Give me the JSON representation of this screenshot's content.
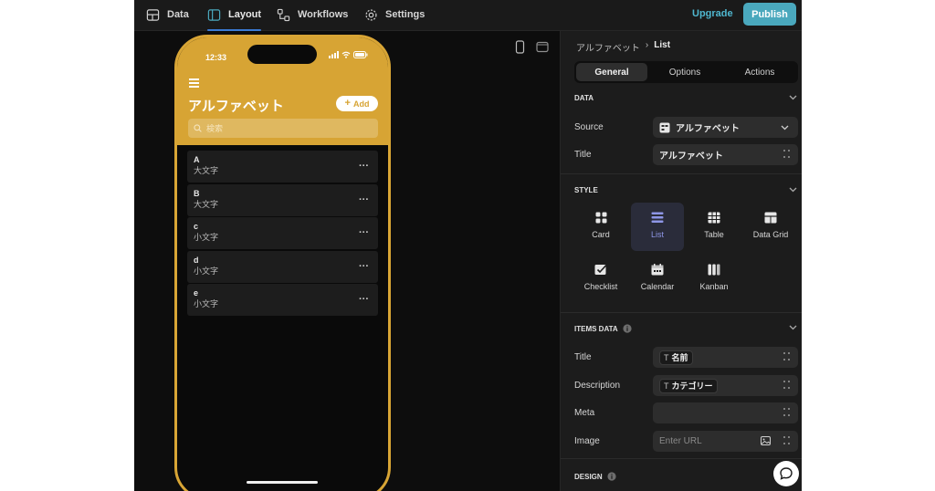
{
  "topbar": {
    "nav": [
      {
        "label": "Data",
        "icon": "table-icon"
      },
      {
        "label": "Layout",
        "icon": "layout-icon"
      },
      {
        "label": "Workflows",
        "icon": "workflow-icon"
      },
      {
        "label": "Settings",
        "icon": "gear-icon"
      }
    ],
    "active_nav": "Layout",
    "upgrade_label": "Upgrade",
    "publish_label": "Publish"
  },
  "phone": {
    "time": "12:33",
    "app_title": "アルファベット",
    "add_label": "Add",
    "search_placeholder": "検索",
    "items": [
      {
        "title": "A",
        "desc": "大文字"
      },
      {
        "title": "B",
        "desc": "大文字"
      },
      {
        "title": "c",
        "desc": "小文字"
      },
      {
        "title": "d",
        "desc": "小文字"
      },
      {
        "title": "e",
        "desc": "小文字"
      }
    ],
    "more_symbol": "···"
  },
  "panel": {
    "breadcrumb": {
      "parent": "アルファベット",
      "separator": "›",
      "current": "List"
    },
    "tabs": [
      "General",
      "Options",
      "Actions"
    ],
    "active_tab": "General",
    "data_section": {
      "heading": "DATA",
      "source_label": "Source",
      "source_value": "アルファベット",
      "title_label": "Title",
      "title_value": "アルファベット"
    },
    "style_section": {
      "heading": "STYLE",
      "styles": [
        "Card",
        "List",
        "Table",
        "Data Grid",
        "Checklist",
        "Calendar",
        "Kanban"
      ],
      "active_style": "List"
    },
    "items_section": {
      "heading": "ITEMS DATA",
      "title_label": "Title",
      "title_value": "名前",
      "description_label": "Description",
      "description_value": "カテゴリー",
      "meta_label": "Meta",
      "image_label": "Image",
      "image_placeholder": "Enter URL"
    },
    "design_section": {
      "heading": "DESIGN"
    }
  },
  "colors": {
    "accent": "#d7a434",
    "publish": "#4aa8bd",
    "active_style": "#8e96e6"
  }
}
